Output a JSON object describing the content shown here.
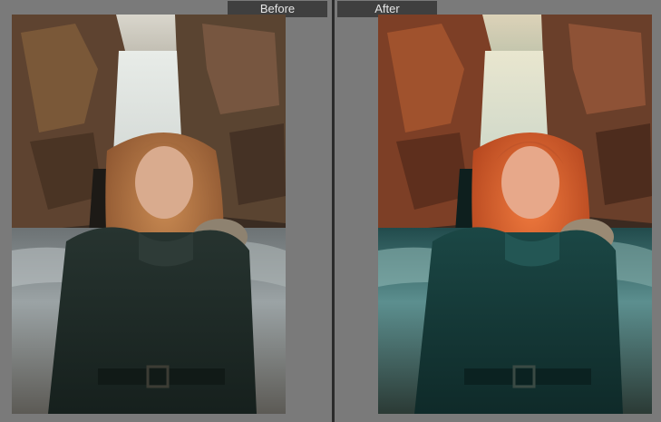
{
  "panels": [
    {
      "label": "Before",
      "variant": "original"
    },
    {
      "label": "After",
      "variant": "color-graded"
    }
  ],
  "colors": {
    "background": "#7a7a7a",
    "label_bg": "#3f3f3f",
    "label_text": "#e6e6e6",
    "divider": "#2b2b2b"
  }
}
